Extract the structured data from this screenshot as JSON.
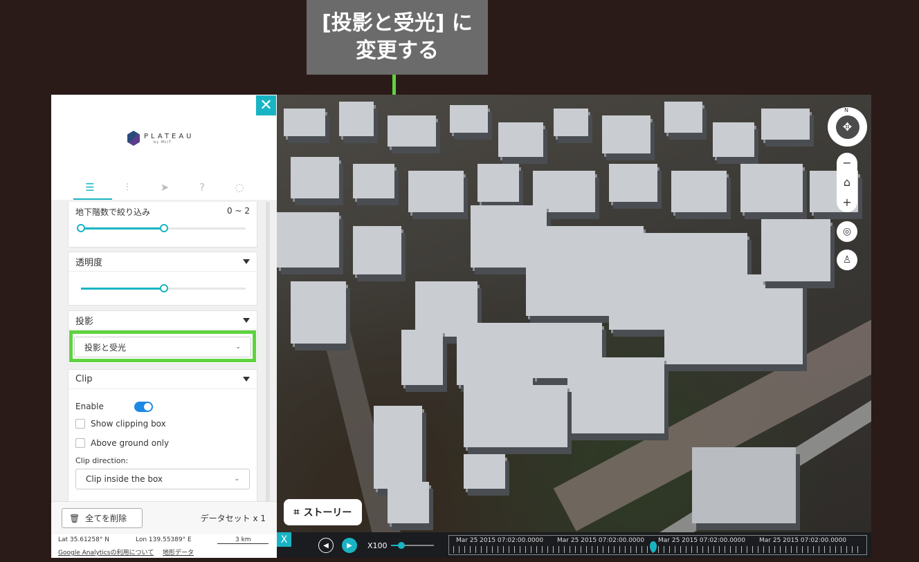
{
  "annotation": {
    "line1": "[投影と受光] に",
    "line2": "変更する"
  },
  "panel": {
    "logo_text": "PLATEAU",
    "logo_sub": "by MLIT",
    "close_icon": "close-icon",
    "tabs": [
      {
        "name": "data-tab",
        "glyph": "≡",
        "active": true
      },
      {
        "name": "settings-tab",
        "glyph": "⫶",
        "active": false
      },
      {
        "name": "share-tab",
        "glyph": "➤",
        "active": false
      },
      {
        "name": "help-tab",
        "glyph": "?",
        "active": false
      },
      {
        "name": "feedback-tab",
        "glyph": "◯",
        "active": false
      }
    ],
    "floor_filter": {
      "label": "地下階数で絞り込み",
      "range": "0 ~ 2"
    },
    "opacity": {
      "label": "透明度",
      "value": 0.6
    },
    "shadow": {
      "label": "投影",
      "selected": "投影と受光"
    },
    "clip": {
      "label": "Clip",
      "enable_label": "Enable",
      "show_box_label": "Show clipping box",
      "above_ground_label": "Above ground only",
      "direction_label": "Clip direction:",
      "direction_selected": "Clip inside the box"
    },
    "delete_all": "全てを削除",
    "dataset_count": "データセット x 1",
    "lat": "Lat  35.61258° N",
    "lon": "Lon  139.55389° E",
    "scale": "3 km",
    "ga_link": "Google Analyticsの利用について",
    "terrain_link": "地形データ"
  },
  "map": {
    "story_button": "ストーリー",
    "compass_n": "N",
    "zoom_out": "−",
    "home": "⌂",
    "zoom_in": "+"
  },
  "timeline": {
    "close": "X",
    "speed": "X100",
    "dates": [
      "Mar 25 2015 07:02:00.0000",
      "Mar 25 2015 07:02:00.0000",
      "Mar 25 2015 07:02:00.0000",
      "Mar 25 2015 07:02:00.0000"
    ]
  }
}
